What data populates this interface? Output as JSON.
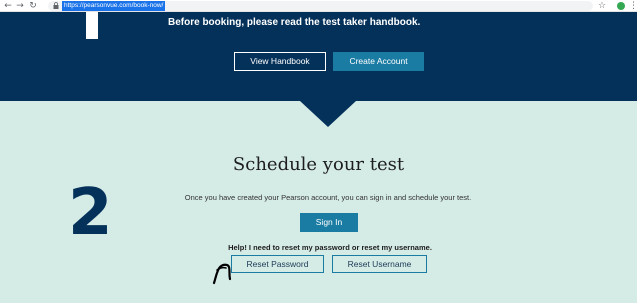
{
  "browser": {
    "back_icon": "arrow-left-icon",
    "forward_icon": "arrow-right-icon",
    "reload_icon": "reload-icon",
    "url": "https://pearsonvue.com/book-now/",
    "star_icon": "star-icon",
    "extension_color": "#34a853",
    "menu_icon": "kebab-menu-icon"
  },
  "step1": {
    "handbook_message": "Before booking, please read the test taker handbook.",
    "view_handbook_label": "View Handbook",
    "create_account_label": "Create Account"
  },
  "step2": {
    "number": "2",
    "title": "Schedule your test",
    "info": "Once you have created your Pearson account, you can sign in and schedule your test.",
    "sign_in_label": "Sign In",
    "help_text": "Help! I need to reset my password or reset my username.",
    "reset_password_label": "Reset Password",
    "reset_username_label": "Reset Username"
  },
  "colors": {
    "navy": "#04315a",
    "teal": "#1a7ca3",
    "mint": "#d5ebe6"
  }
}
